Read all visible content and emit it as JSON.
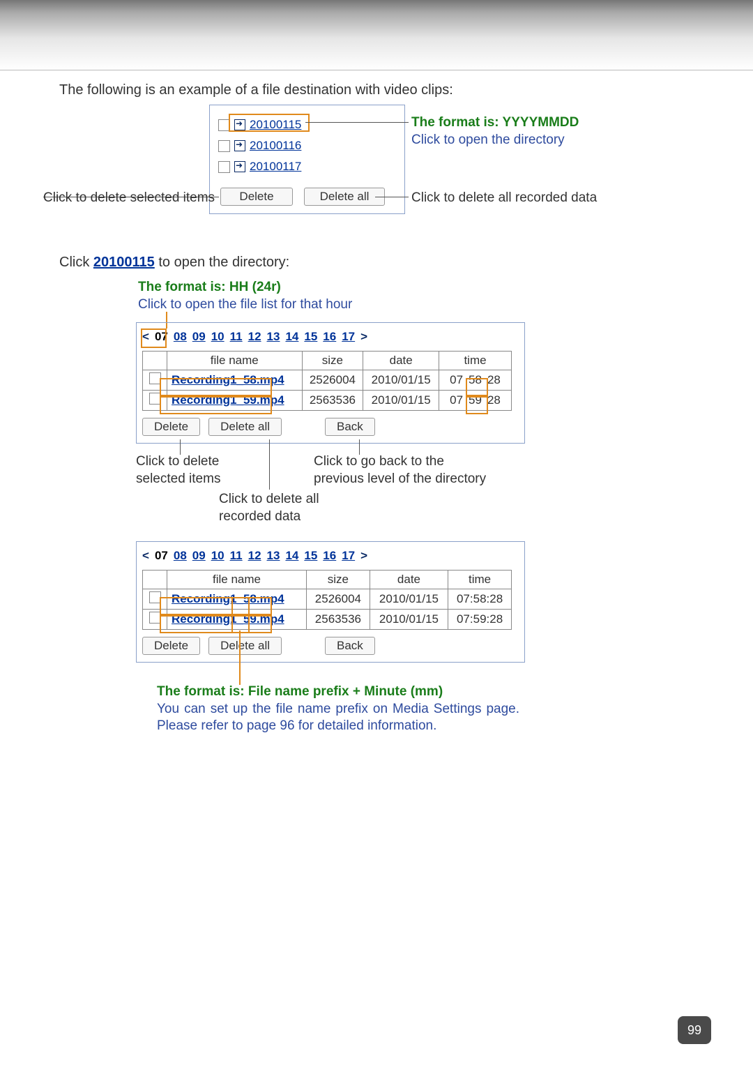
{
  "intro": "The following is an example of a file destination with video clips:",
  "shot1": {
    "folders": [
      "20100115",
      "20100116",
      "20100117"
    ],
    "delete": "Delete",
    "delete_all": "Delete all"
  },
  "callouts": {
    "delete_selected": "Click to delete selected items",
    "delete_all_data": "Click to delete all recorded data",
    "format_ymd": "The format is: YYYYMMDD",
    "open_dir": "Click to open the directory",
    "format_hh": "The format is: HH (24r)",
    "open_file_list": "Click to open the file list for that hour",
    "del_sel2": "Click to delete selected items",
    "del_all2": "Click to delete all recorded data",
    "back2": "Click to go back to the previous level of the directory",
    "format_fn": "The format is: File name prefix + Minute (mm)",
    "media_settings": "You can set up the file name prefix on Media Settings page. Please refer to page 96 for detailed information."
  },
  "click_line": {
    "pre": "Click ",
    "link": "20100115",
    "post": " to open the directory:"
  },
  "hours": {
    "nav_left": "<",
    "nav_right": ">",
    "selected": "07",
    "list": [
      "08",
      "09",
      "10",
      "11",
      "12",
      "13",
      "14",
      "15",
      "16",
      "17"
    ]
  },
  "file_headers": {
    "name": "file name",
    "size": "size",
    "date": "date",
    "time": "time"
  },
  "files": [
    {
      "name": "Recording1_58.mp4",
      "size": "2526004",
      "date": "2010/01/15",
      "h": "07",
      "m": "58",
      "s": "28"
    },
    {
      "name": "Recording1_59.mp4",
      "size": "2563536",
      "date": "2010/01/15",
      "h": "07",
      "m": "59",
      "s": "28"
    }
  ],
  "buttons": {
    "delete": "Delete",
    "delete_all": "Delete all",
    "back": "Back"
  },
  "page_number": "99"
}
